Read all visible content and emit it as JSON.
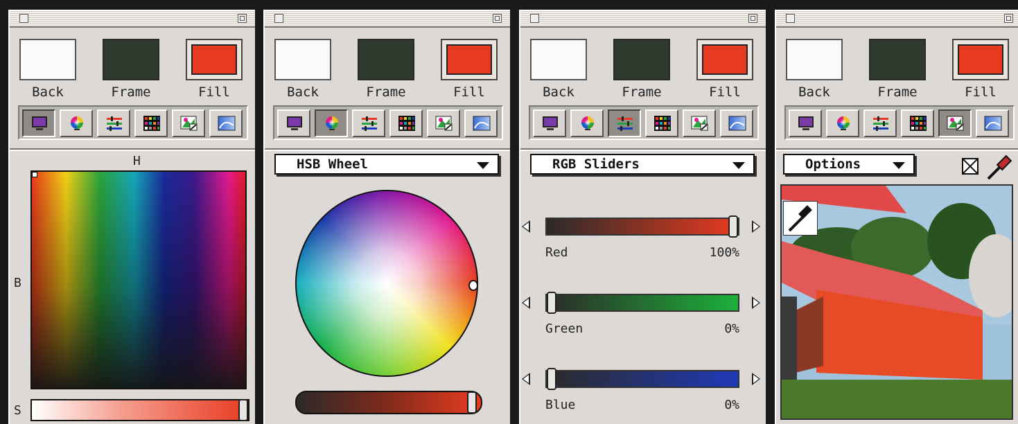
{
  "colors": {
    "back": "#fafafa",
    "frame": "#2f3a2f",
    "fill": "#e83a20"
  },
  "swatch_labels": {
    "back": "Back",
    "frame": "Frame",
    "fill": "Fill"
  },
  "toolbar_icons": [
    "monitor-icon",
    "color-wheel-icon",
    "sliders-icon",
    "swatch-grid-icon",
    "image-picker-icon",
    "gradient-icon"
  ],
  "panels": [
    {
      "selected_tool": "monitor-icon",
      "axis_h": "H",
      "axis_b": "B",
      "axis_s": "S",
      "saturation_level": 1.0
    },
    {
      "selected_tool": "color-wheel-icon",
      "popup": "HSB Wheel",
      "brightness_level": 1.0
    },
    {
      "selected_tool": "sliders-icon",
      "popup": "RGB Sliders",
      "sliders": [
        {
          "label": "Red",
          "value": "100%",
          "level": 1.0,
          "color": "#e83a20"
        },
        {
          "label": "Green",
          "value": "0%",
          "level": 0.0,
          "color": "#1db03a"
        },
        {
          "label": "Blue",
          "value": "0%",
          "level": 0.0,
          "color": "#1f3ab8"
        }
      ]
    },
    {
      "selected_tool": "image-picker-icon",
      "popup": "Options"
    }
  ]
}
